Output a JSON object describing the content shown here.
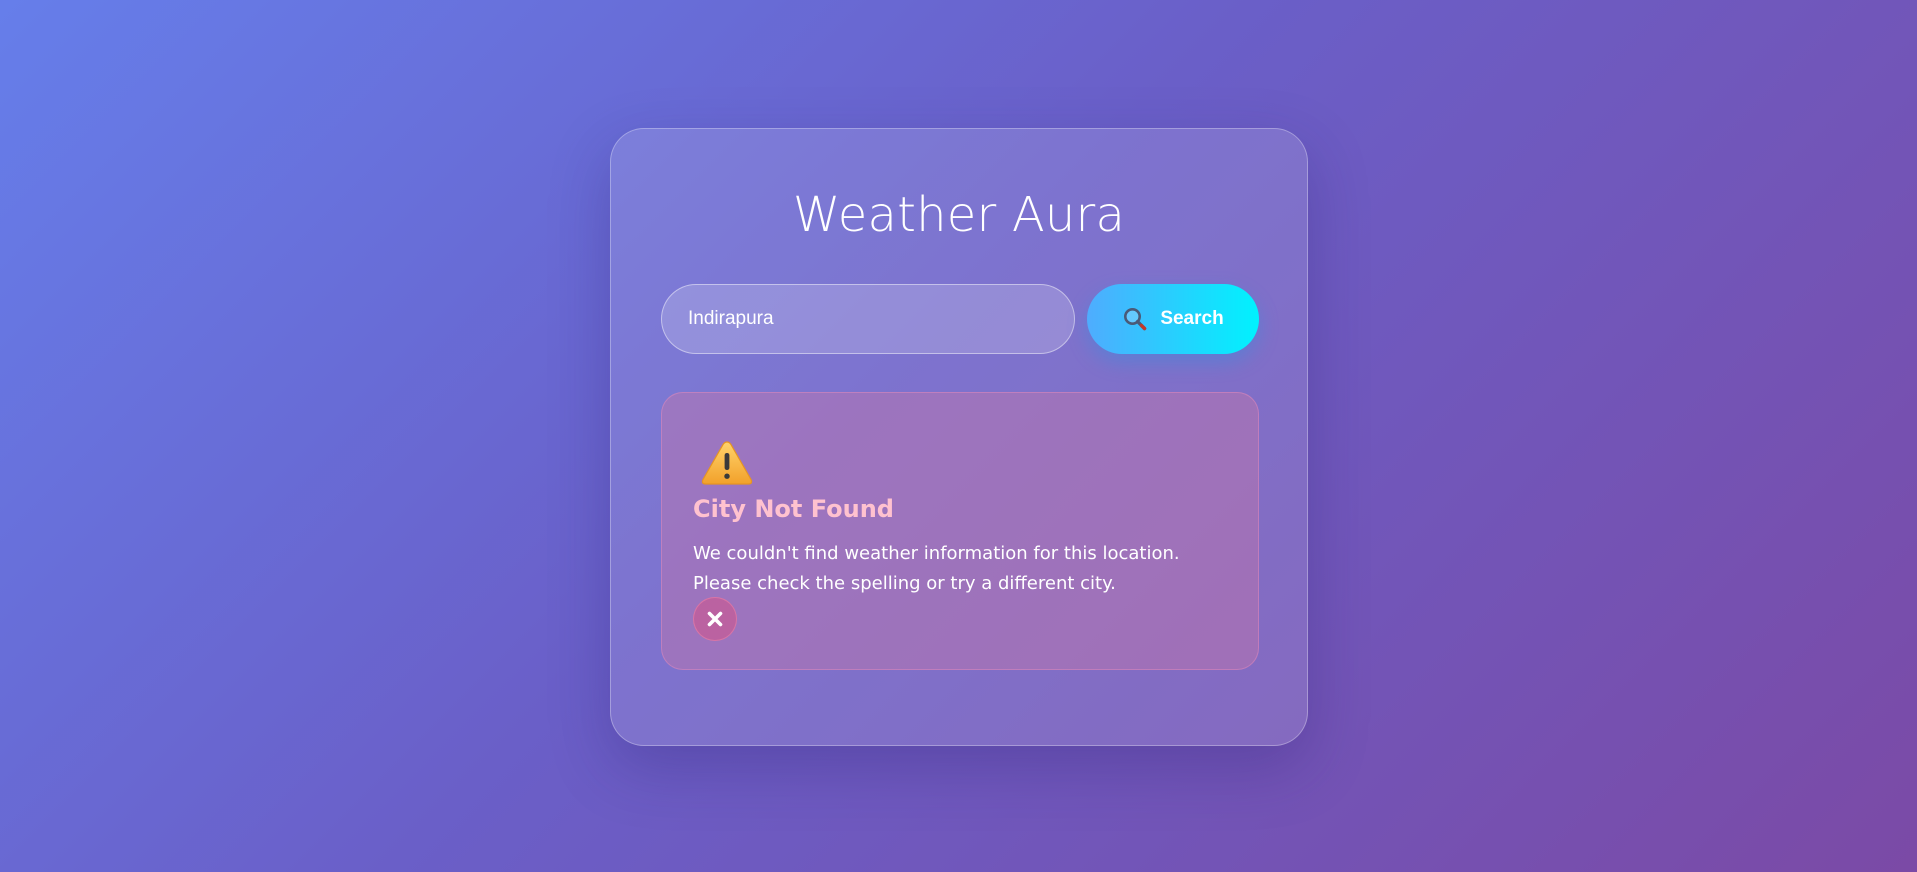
{
  "app": {
    "title": "Weather Aura"
  },
  "search": {
    "value": "Indirapura",
    "button_label": "Search",
    "button_icon": "search-icon"
  },
  "error": {
    "icon": "warning-icon",
    "title": "City Not Found",
    "message": "We couldn't find weather information for this location. Please check the spelling or try a different city.",
    "dismiss_icon": "close-icon"
  },
  "colors": {
    "background_start": "#667eea",
    "background_end": "#7b4aa6",
    "button_start": "#4facfe",
    "button_end": "#00f2fe",
    "error_title": "#ffc2cf"
  }
}
